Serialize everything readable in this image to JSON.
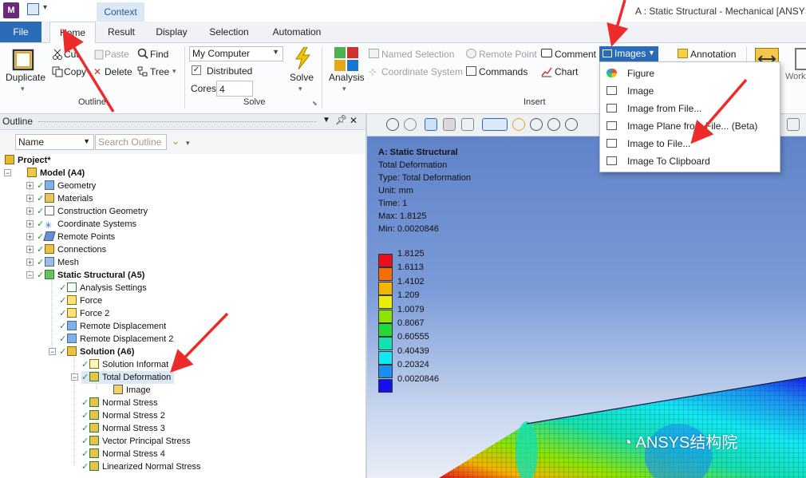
{
  "app": {
    "logo_letter": "M",
    "window_title": "A : Static Structural - Mechanical [ANSYS M",
    "context_tab": "Context"
  },
  "tabs": [
    "File",
    "Home",
    "Result",
    "Display",
    "Selection",
    "Automation"
  ],
  "ribbon": {
    "duplicate": "Duplicate",
    "cut": "Cut",
    "copy": "Copy",
    "paste": "Paste",
    "delete": "Delete",
    "find": "Find",
    "tree": "Tree",
    "outline_group": "Outline",
    "solve_target": "My Computer",
    "distributed": "Distributed",
    "cores_label": "Cores",
    "cores_value": "4",
    "solve_button": "Solve",
    "solve_group": "Solve",
    "analysis": "Analysis",
    "named_selection": "Named Selection",
    "coordinate_system": "Coordinate System",
    "remote_point": "Remote Point",
    "commands": "Commands",
    "comment": "Comment",
    "chart": "Chart",
    "images": "Images",
    "annotation": "Annotation",
    "insert_group": "Insert",
    "work": "Work"
  },
  "images_menu": [
    "Figure",
    "Image",
    "Image from File...",
    "Image Plane from File... (Beta)",
    "Image to File...",
    "Image To Clipboard"
  ],
  "outline": {
    "title": "Outline",
    "name_filter": "Name",
    "search_placeholder": "Search Outline",
    "tree": [
      {
        "label": "Project*",
        "bold": true
      },
      {
        "label": "Model (A4)",
        "bold": true
      },
      {
        "label": "Geometry"
      },
      {
        "label": "Materials"
      },
      {
        "label": "Construction Geometry"
      },
      {
        "label": "Coordinate Systems"
      },
      {
        "label": "Remote Points"
      },
      {
        "label": "Connections"
      },
      {
        "label": "Mesh"
      },
      {
        "label": "Static Structural (A5)",
        "bold": true
      },
      {
        "label": "Analysis Settings"
      },
      {
        "label": "Force"
      },
      {
        "label": "Force 2"
      },
      {
        "label": "Remote Displacement"
      },
      {
        "label": "Remote Displacement 2"
      },
      {
        "label": "Solution (A6)",
        "bold": true
      },
      {
        "label": "Solution Informat"
      },
      {
        "label": "Total Deformation"
      },
      {
        "label": "Image"
      },
      {
        "label": "Normal Stress"
      },
      {
        "label": "Normal Stress 2"
      },
      {
        "label": "Normal Stress 3"
      },
      {
        "label": "Vector Principal Stress"
      },
      {
        "label": "Normal Stress 4"
      },
      {
        "label": "Linearized Normal Stress"
      }
    ]
  },
  "viewport": {
    "header_lines": [
      "A: Static Structural",
      "Total Deformation",
      "Type: Total Deformation",
      "Unit: mm",
      "Time: 1",
      "Max: 1.8125",
      "Min: 0.0020846"
    ],
    "legend": [
      {
        "value": "1.8125",
        "color": "#e8101a"
      },
      {
        "value": "1.6113",
        "color": "#f16e08"
      },
      {
        "value": "1.4102",
        "color": "#f4b400"
      },
      {
        "value": "1.209",
        "color": "#e8ef00"
      },
      {
        "value": "1.0079",
        "color": "#8ee400"
      },
      {
        "value": "0.8067",
        "color": "#22d93a"
      },
      {
        "value": "0.60555",
        "color": "#14e0b0"
      },
      {
        "value": "0.40439",
        "color": "#12e8f3"
      },
      {
        "value": "0.20324",
        "color": "#1b8cf1"
      },
      {
        "value": "0.0020846",
        "color": "#1410ee"
      }
    ],
    "watermark": "ANSYS结构院"
  },
  "colors": {
    "accent": "#2b6cb8",
    "arrow": "#ee2b2b"
  }
}
